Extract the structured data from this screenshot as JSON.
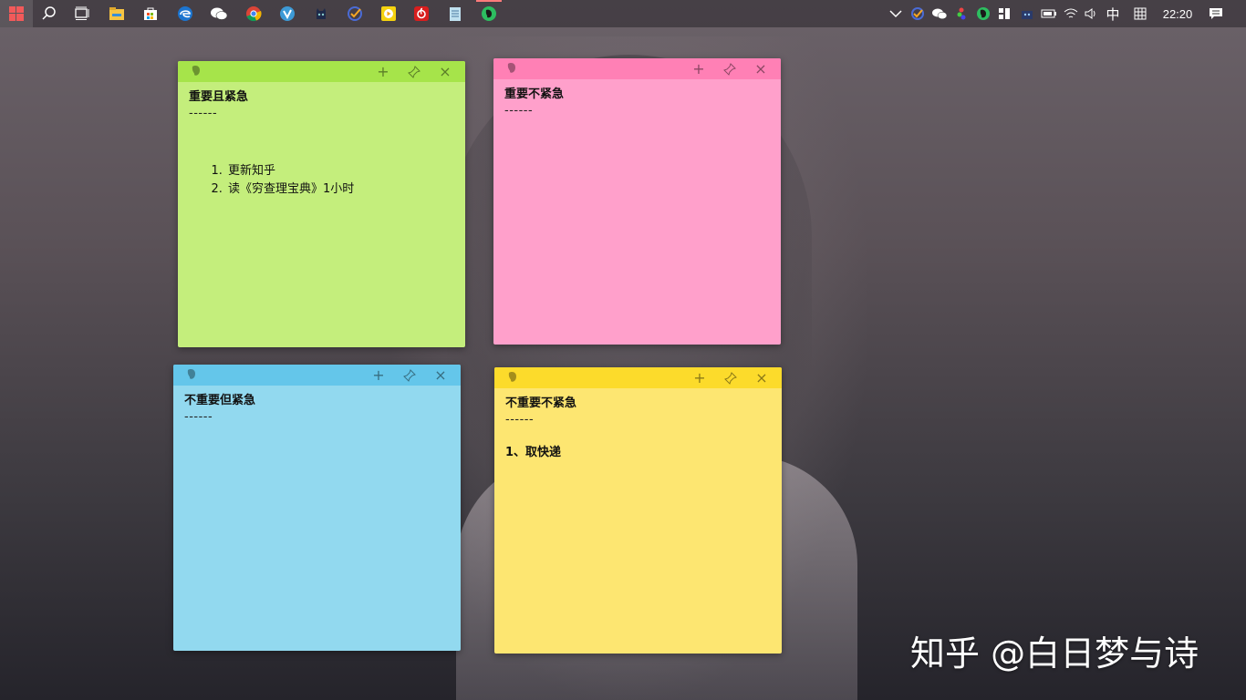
{
  "taskbar": {
    "clock": "22:20",
    "ime": "中",
    "pinned_apps": [
      {
        "icon": "search-icon"
      },
      {
        "icon": "task-view-icon"
      },
      {
        "icon": "file-explorer-icon"
      },
      {
        "icon": "store-icon"
      },
      {
        "icon": "edge-icon"
      },
      {
        "icon": "wechat-icon"
      },
      {
        "icon": "chrome-icon"
      },
      {
        "icon": "vivaldi-icon"
      },
      {
        "icon": "game-icon"
      },
      {
        "icon": "ticktick-icon"
      },
      {
        "icon": "media-player-icon"
      },
      {
        "icon": "netease-music-icon"
      },
      {
        "icon": "notepad-icon"
      },
      {
        "icon": "evernote-icon"
      }
    ]
  },
  "notes": {
    "green": {
      "title": "重要且紧急",
      "separator": "------",
      "items": [
        "更新知乎",
        "读《穷查理宝典》1小时"
      ],
      "header_color": "#a6e44a",
      "body_color": "#c4ee7c"
    },
    "pink": {
      "title": "重要不紧急",
      "separator": "------",
      "header_color": "#ff80b5",
      "body_color": "#ffa0cb"
    },
    "blue": {
      "title": "不重要但紧急",
      "separator": "------",
      "header_color": "#64c6ea",
      "body_color": "#92d9ef"
    },
    "yellow": {
      "title": "不重要不紧急",
      "separator": "------",
      "text": "1、取快递",
      "header_color": "#fcdb2b",
      "body_color": "#fde671"
    }
  },
  "note_controls": {
    "add": "+",
    "pin": "pin-icon",
    "close": "×"
  },
  "watermark": "知乎 @白日梦与诗"
}
